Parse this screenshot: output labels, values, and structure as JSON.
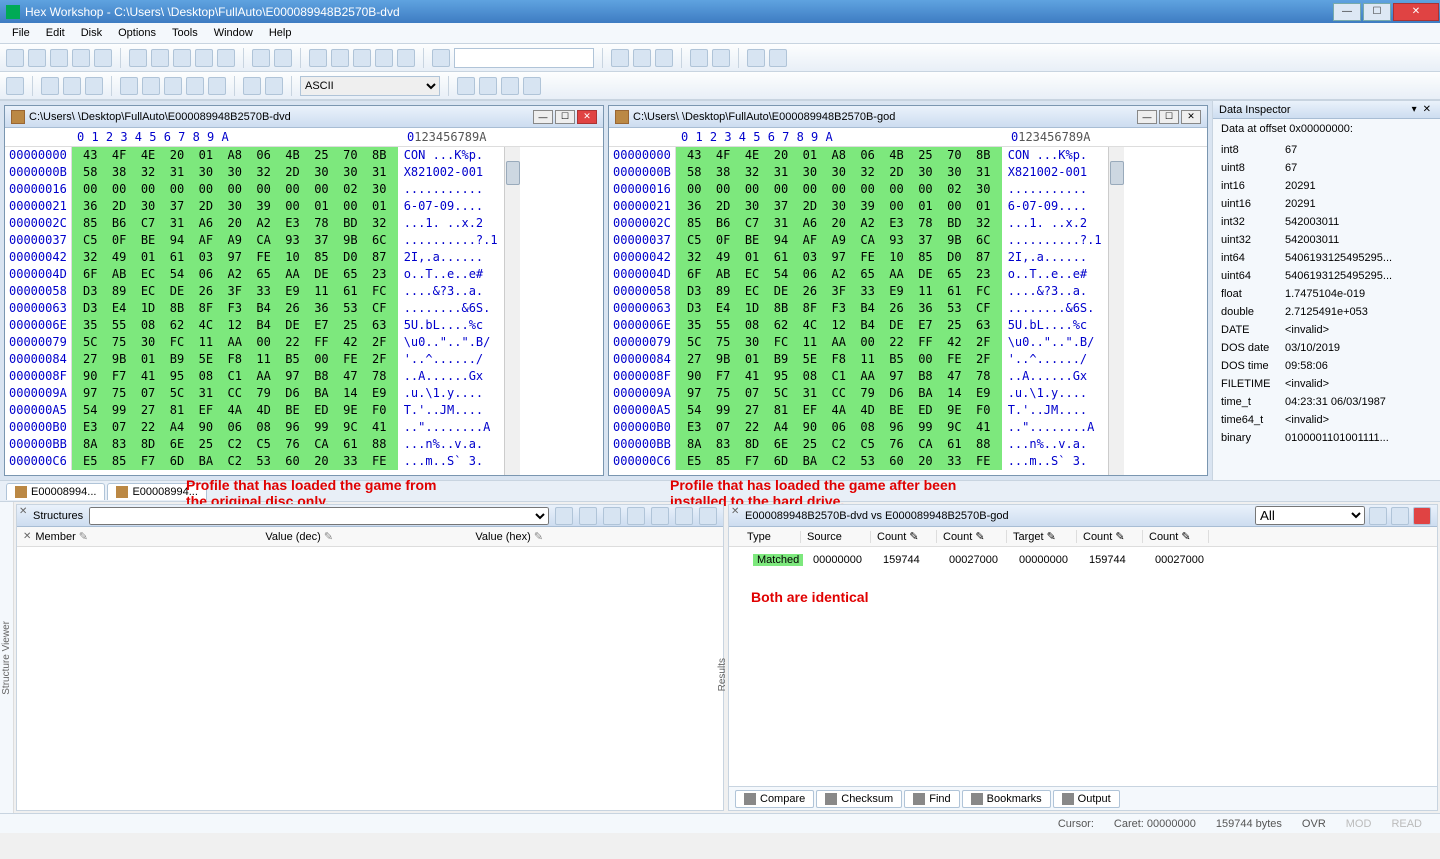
{
  "title": "Hex Workshop - C:\\Users\\        \\Desktop\\FullAuto\\E000089948B2570B-dvd",
  "menus": [
    "File",
    "Edit",
    "Disk",
    "Options",
    "Tools",
    "Window",
    "Help"
  ],
  "encoding_select": "ASCII",
  "pane1": {
    "title": "C:\\Users\\        \\Desktop\\FullAuto\\E000089948B2570B-dvd",
    "col_header_hex": " 0   1   2   3   4   5   6   7   8   9   A",
    "col_header_ascii_pre": "0",
    "col_header_ascii_post": "123456789A",
    "offsets": [
      "00000000",
      "0000000B",
      "00000016",
      "00000021",
      "0000002C",
      "00000037",
      "00000042",
      "0000004D",
      "00000058",
      "00000063",
      "0000006E",
      "00000079",
      "00000084",
      "0000008F",
      "0000009A",
      "000000A5",
      "000000B0",
      "000000BB",
      "000000C6"
    ],
    "hex": [
      "43  4F  4E  20  01  A8  06  4B  25  70  8B",
      "58  38  32  31  30  30  32  2D  30  30  31",
      "00  00  00  00  00  00  00  00  00  02  30",
      "36  2D  30  37  2D  30  39  00  01  00  01",
      "85  B6  C7  31  A6  20  A2  E3  78  BD  32",
      "C5  0F  BE  94  AF  A9  CA  93  37  9B  6C",
      "32  49  01  61  03  97  FE  10  85  D0  87",
      "6F  AB  EC  54  06  A2  65  AA  DE  65  23",
      "D3  89  EC  DE  26  3F  33  E9  11  61  FC",
      "D3  E4  1D  8B  8F  F3  B4  26  36  53  CF",
      "35  55  08  62  4C  12  B4  DE  E7  25  63",
      "5C  75  30  FC  11  AA  00  22  FF  42  2F",
      "27  9B  01  B9  5E  F8  11  B5  00  FE  2F",
      "90  F7  41  95  08  C1  AA  97  B8  47  78",
      "97  75  07  5C  31  CC  79  D6  BA  14  E9",
      "54  99  27  81  EF  4A  4D  BE  ED  9E  F0",
      "E3  07  22  A4  90  06  08  96  99  9C  41",
      "8A  83  8D  6E  25  C2  C5  76  CA  61  88",
      "E5  85  F7  6D  BA  C2  53  60  20  33  FE"
    ],
    "ascii": [
      "CON ...K%p.",
      "X821002-001",
      "...........",
      "6-07-09....",
      "...1. ..x.2",
      "..........?.1",
      "2I,.a......",
      "o..T..e..e#",
      "....&?3..a.",
      "........&6S.",
      "5U.bL....%c",
      "\\u0..\"..\".B/",
      "'..^....../",
      "..A......Gx",
      ".u.\\1.y....",
      "T.'..JM....",
      "..\"........A",
      "...n%..v.a.",
      "...m..S` 3."
    ]
  },
  "pane2": {
    "title": "C:\\Users\\        \\Desktop\\FullAuto\\E000089948B2570B-god"
  },
  "inspector": {
    "header": "Data Inspector",
    "subheader": "Data at offset 0x00000000:",
    "rows": [
      {
        "k": "int8",
        "v": "67"
      },
      {
        "k": "uint8",
        "v": "67"
      },
      {
        "k": "int16",
        "v": "20291"
      },
      {
        "k": "uint16",
        "v": "20291"
      },
      {
        "k": "int32",
        "v": "542003011"
      },
      {
        "k": "uint32",
        "v": "542003011"
      },
      {
        "k": "int64",
        "v": "5406193125495295..."
      },
      {
        "k": "uint64",
        "v": "5406193125495295..."
      },
      {
        "k": "float",
        "v": "1.7475104e-019"
      },
      {
        "k": "double",
        "v": "2.7125491e+053"
      },
      {
        "k": "DATE",
        "v": "<invalid>"
      },
      {
        "k": "DOS date",
        "v": "03/10/2019"
      },
      {
        "k": "DOS time",
        "v": "09:58:06"
      },
      {
        "k": "FILETIME",
        "v": "<invalid>"
      },
      {
        "k": "time_t",
        "v": "04:23:31 06/03/1987"
      },
      {
        "k": "time64_t",
        "v": "<invalid>"
      },
      {
        "k": "binary",
        "v": "0100001101001111..."
      }
    ]
  },
  "file_tabs": [
    "E00008994...",
    "E00008994..."
  ],
  "annot1a": "Profile that has loaded the game from",
  "annot1b": "the original disc only.",
  "annot2a": "Profile that has loaded the game after been",
  "annot2b": "installed to the hard drive.",
  "struct": {
    "label": "Structures",
    "cols": [
      "Member",
      "Value (dec)",
      "Value (hex)"
    ],
    "sidelabel": "Structure Viewer"
  },
  "results": {
    "title": "E000089948B2570B-dvd vs E000089948B2570B-god",
    "filter": "All",
    "cols": [
      "Type",
      "Source",
      "Count",
      "Count",
      "Target",
      "Count",
      "Count"
    ],
    "row": {
      "type": "Matched",
      "source": "00000000",
      "count1": "159744",
      "count2": "00027000",
      "target": "00000000",
      "count3": "159744",
      "count4": "00027000"
    },
    "annot": "Both are identical",
    "sidelabel": "Results",
    "tabs": [
      "Compare",
      "Checksum",
      "Find",
      "Bookmarks",
      "Output"
    ]
  },
  "status": {
    "cursor": "Cursor:",
    "caret": "Caret: 00000000",
    "bytes": "159744 bytes",
    "ovr": "OVR",
    "mod": "MOD",
    "read": "READ"
  }
}
